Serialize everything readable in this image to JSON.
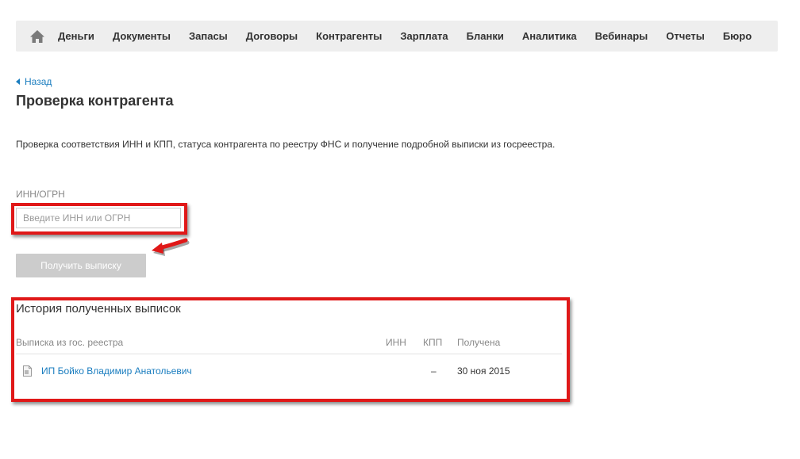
{
  "nav": {
    "home_icon": "home-icon",
    "items": [
      "Деньги",
      "Документы",
      "Запасы",
      "Договоры",
      "Контрагенты",
      "Зарплата",
      "Бланки",
      "Аналитика",
      "Вебинары",
      "Отчеты",
      "Бюро"
    ]
  },
  "header": {
    "back_label": "Назад",
    "title": "Проверка контрагента",
    "description": "Проверка соответствия ИНН и КПП, статуса контрагента по реестру ФНС и получение подробной выписки из госреестра."
  },
  "form": {
    "field_label": "ИНН/ОГРН",
    "input_value": "",
    "input_placeholder": "Введите ИНН или ОГРН",
    "submit_label": "Получить выписку"
  },
  "history": {
    "title": "История полученных выписок",
    "columns": [
      "Выписка из гос. реестра",
      "ИНН",
      "КПП",
      "Получена"
    ],
    "rows": [
      {
        "name": "ИП Бойко Владимир Анатольевич",
        "inn": "",
        "kpp": "–",
        "date": "30 ноя 2015",
        "icon": "document-icon"
      }
    ]
  },
  "colors": {
    "link": "#1a7dbf",
    "annotation": "#e01818",
    "nav_bg": "#eeeeee",
    "button_disabled": "#cccccc"
  }
}
